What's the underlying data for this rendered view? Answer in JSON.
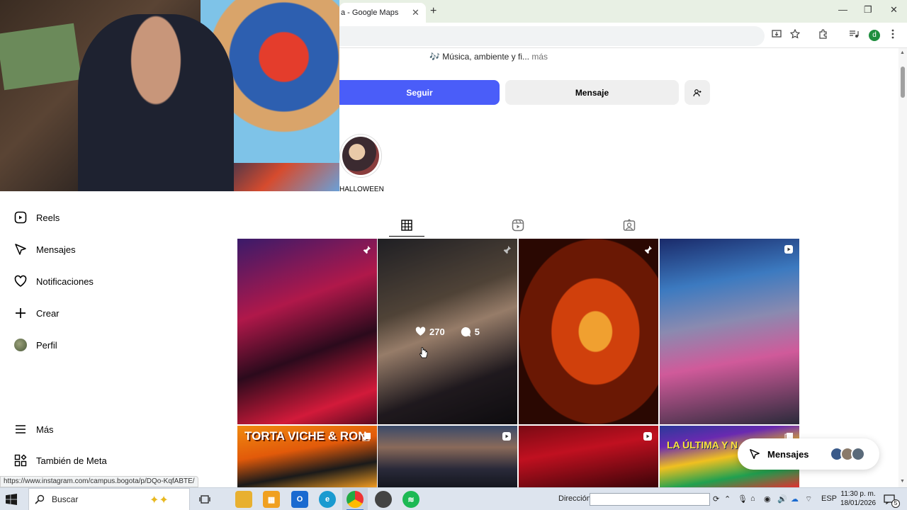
{
  "browser": {
    "tab_title": "a - Google Maps",
    "tab_close": "✕",
    "new_tab": "+",
    "minimize": "—",
    "maximize": "❐",
    "close": "✕",
    "status_url": "https://www.instagram.com/campus.bogota/p/DQo-KqfABTE/"
  },
  "profile": {
    "bio_line": "Música, ambiente y fi...",
    "bio_more": "más",
    "follow_label": "Seguir",
    "message_label": "Mensaje",
    "highlight_label": "HALLOWEEN"
  },
  "sidebar": {
    "items": [
      {
        "label": "Reels",
        "icon": "reels-icon"
      },
      {
        "label": "Mensajes",
        "icon": "messenger-icon"
      },
      {
        "label": "Notificaciones",
        "icon": "heart-icon"
      },
      {
        "label": "Crear",
        "icon": "plus-icon"
      },
      {
        "label": "Perfil",
        "icon": "avatar"
      },
      {
        "label": "Más",
        "icon": "menu-icon"
      },
      {
        "label": "También de Meta",
        "icon": "meta-apps-icon"
      }
    ]
  },
  "grid": {
    "tiles": [
      {
        "badge": "pin-icon"
      },
      {
        "badge": "pin-icon",
        "likes": "270",
        "comments": "5"
      },
      {
        "badge": "pin-icon"
      },
      {
        "badge": "reel-icon"
      },
      {
        "badge": "carousel-icon",
        "text": "TORTA VICHE & RON"
      },
      {
        "badge": "reel-icon"
      },
      {
        "badge": "reel-icon"
      },
      {
        "badge": "carousel-icon",
        "text": "LA ÚLTIMA Y N"
      }
    ]
  },
  "messages_pill": {
    "label": "Mensajes"
  },
  "taskbar": {
    "search_placeholder": "Buscar",
    "address_label": "Dirección",
    "language": "ESP",
    "time": "11:30 p. m.",
    "date": "18/01/2026",
    "notification_count": "5"
  },
  "colors": {
    "follow_button": "#4a5df9",
    "secondary_button": "#efefef",
    "taskbar": "#dde4ee"
  }
}
